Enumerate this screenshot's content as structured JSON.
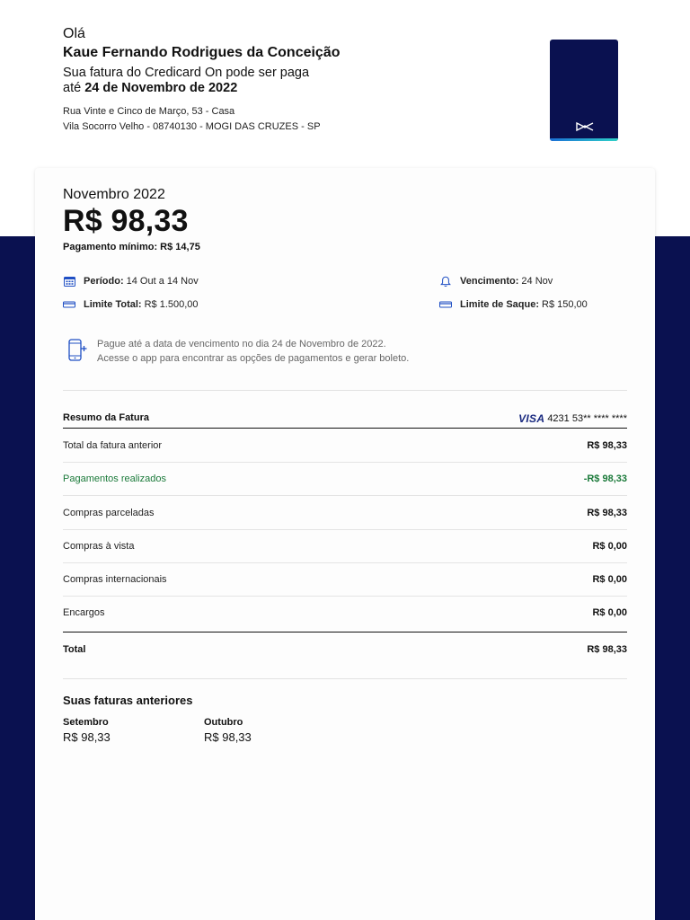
{
  "header": {
    "greeting": "Olá",
    "name": "Kaue Fernando Rodrigues da Conceição",
    "line1": "Sua fatura do Credicard On pode ser paga",
    "line2_prefix": "até",
    "line2_date": "24 de Novembro de 2022",
    "address_line1": "Rua Vinte e Cinco de Março, 53 - Casa",
    "address_line2": "Vila Socorro Velho - 08740130 - MOGI DAS CRUZES - SP"
  },
  "statement": {
    "month": "Novembro 2022",
    "amount": "R$ 98,33",
    "min_payment": "Pagamento mínimo: R$ 14,75"
  },
  "info": {
    "periodo_label": "Período:",
    "periodo_value": "14 Out a 14 Nov",
    "vencimento_label": "Vencimento:",
    "vencimento_value": "24 Nov",
    "limite_total_label": "Limite Total:",
    "limite_total_value": "R$ 1.500,00",
    "limite_saque_label": "Limite de Saque:",
    "limite_saque_value": "R$ 150,00"
  },
  "notice": {
    "line1": "Pague até a data de vencimento no dia 24 de Novembro de 2022.",
    "line2": "Acesse o app para encontrar as opções de pagamentos e gerar boleto."
  },
  "resumo": {
    "title": "Resumo da Fatura",
    "card_brand": "VISA",
    "card_number": "4231 53** **** ****",
    "rows": [
      {
        "label": "Total da fatura anterior",
        "value": "R$ 98,33"
      },
      {
        "label": "Pagamentos realizados",
        "value": "-R$ 98,33"
      },
      {
        "label": "Compras parceladas",
        "value": "R$ 98,33"
      },
      {
        "label": "Compras à vista",
        "value": "R$ 0,00"
      },
      {
        "label": "Compras internacionais",
        "value": "R$ 0,00"
      },
      {
        "label": "Encargos",
        "value": "R$ 0,00"
      }
    ],
    "total_label": "Total",
    "total_value": "R$ 98,33"
  },
  "previous": {
    "title": "Suas faturas anteriores",
    "items": [
      {
        "month": "Setembro",
        "value": "R$ 98,33"
      },
      {
        "month": "Outubro",
        "value": "R$ 98,33"
      }
    ]
  },
  "colors": {
    "navy": "#0a1150",
    "green": "#1b7a3a",
    "icon_blue": "#1f4fc4"
  }
}
